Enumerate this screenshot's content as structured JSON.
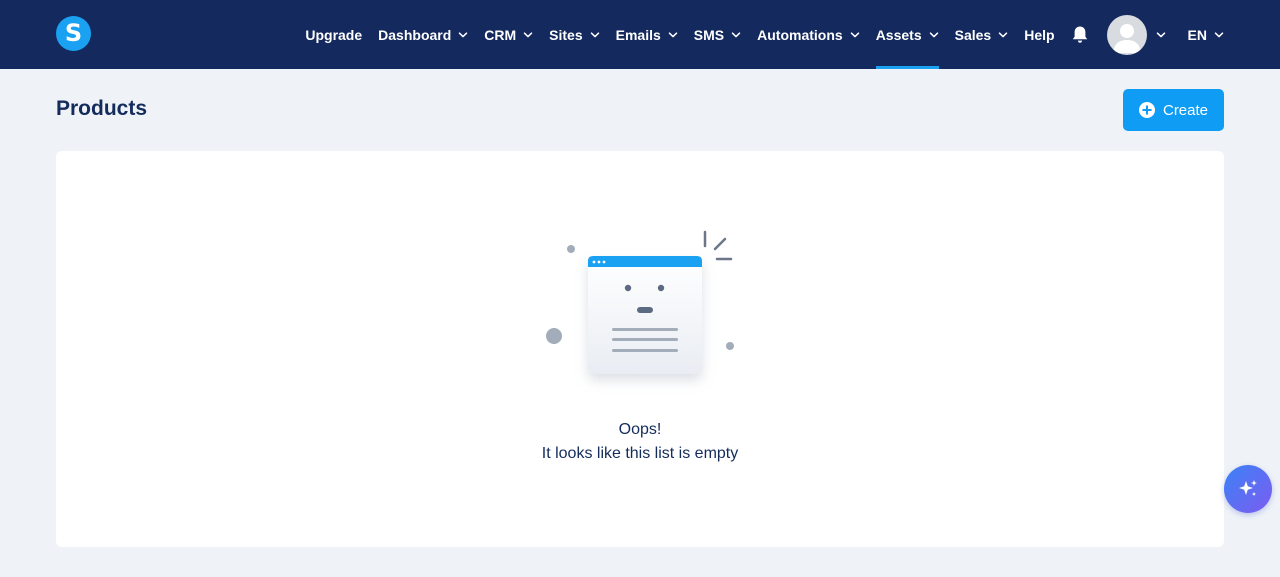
{
  "brand": {
    "logo_letter": "S",
    "accent": "#1ba1f1",
    "navbar_bg": "#14295e"
  },
  "nav": {
    "items": [
      {
        "label": "Upgrade",
        "dropdown": false
      },
      {
        "label": "Dashboard",
        "dropdown": true
      },
      {
        "label": "CRM",
        "dropdown": true
      },
      {
        "label": "Sites",
        "dropdown": true
      },
      {
        "label": "Emails",
        "dropdown": true
      },
      {
        "label": "SMS",
        "dropdown": true
      },
      {
        "label": "Automations",
        "dropdown": true
      },
      {
        "label": "Assets",
        "dropdown": true,
        "active": true
      },
      {
        "label": "Sales",
        "dropdown": true
      },
      {
        "label": "Help",
        "dropdown": false
      }
    ],
    "notifications_icon": "bell-icon",
    "language": "EN"
  },
  "page": {
    "title": "Products",
    "create_label": "Create"
  },
  "empty_state": {
    "title": "Oops!",
    "subtitle": "It looks like this list is empty"
  },
  "ai_button_icon": "sparkle-icon"
}
